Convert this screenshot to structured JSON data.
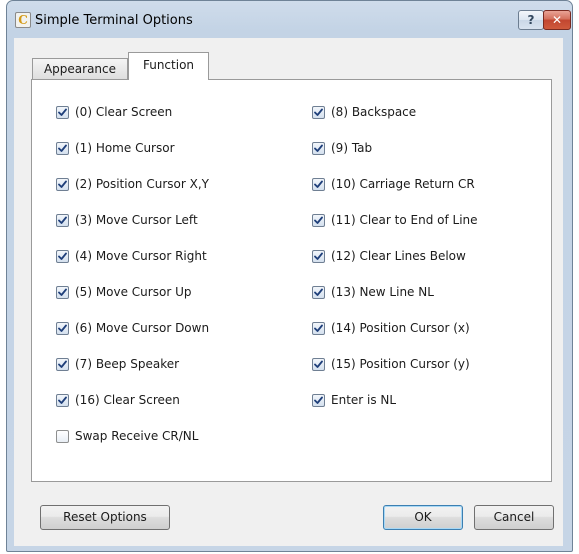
{
  "window": {
    "title": "Simple Terminal Options",
    "app_icon_glyph": "C",
    "help_glyph": "?",
    "close_glyph": "✕"
  },
  "tabs": [
    {
      "label": "Appearance",
      "active": false
    },
    {
      "label": "Function",
      "active": true
    }
  ],
  "left_options": [
    {
      "label": "(0) Clear Screen",
      "checked": true
    },
    {
      "label": "(1) Home Cursor",
      "checked": true
    },
    {
      "label": "(2) Position Cursor X,Y",
      "checked": true
    },
    {
      "label": "(3) Move Cursor Left",
      "checked": true
    },
    {
      "label": "(4) Move Cursor Right",
      "checked": true
    },
    {
      "label": "(5) Move Cursor Up",
      "checked": true
    },
    {
      "label": "(6) Move Cursor Down",
      "checked": true
    },
    {
      "label": "(7) Beep Speaker",
      "checked": true
    },
    {
      "label": "(16) Clear Screen",
      "checked": true
    },
    {
      "label": "Swap Receive CR/NL",
      "checked": false
    }
  ],
  "right_options": [
    {
      "label": "(8) Backspace",
      "checked": true
    },
    {
      "label": "(9) Tab",
      "checked": true
    },
    {
      "label": "(10) Carriage Return CR",
      "checked": true
    },
    {
      "label": "(11) Clear to End of Line",
      "checked": true
    },
    {
      "label": "(12) Clear Lines Below",
      "checked": true
    },
    {
      "label": "(13) New Line NL",
      "checked": true
    },
    {
      "label": "(14) Position Cursor (x)",
      "checked": true
    },
    {
      "label": "(15) Position Cursor (y)",
      "checked": true
    },
    {
      "label": "Enter is NL",
      "checked": true
    }
  ],
  "buttons": {
    "reset": "Reset Options",
    "ok": "OK",
    "cancel": "Cancel"
  },
  "colors": {
    "checkmark": "#1f3f7a",
    "frame_accent": "#c3d3e5",
    "close_button": "#c24630"
  }
}
